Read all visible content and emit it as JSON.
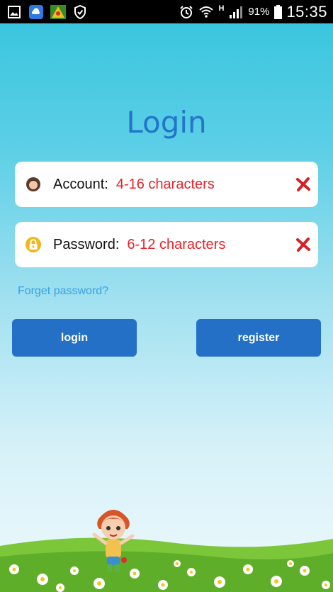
{
  "status_bar": {
    "network_type": "H",
    "battery_percent": "91%",
    "time": "15:35",
    "icons": [
      "gallery-icon",
      "cloud-app-icon",
      "game-app-icon",
      "shield-icon",
      "alarm-icon",
      "wifi-icon",
      "signal-icon",
      "battery-icon"
    ]
  },
  "title": "Login",
  "account": {
    "label": "Account:",
    "placeholder": "4-16 characters",
    "lead_icon": "avatar-icon",
    "clear_icon": "clear-icon"
  },
  "password": {
    "label": "Password:",
    "placeholder": "6-12 characters",
    "lead_icon": "lock-icon",
    "clear_icon": "clear-icon"
  },
  "forget_password": "Forget password?",
  "buttons": {
    "login": "login",
    "register": "register"
  },
  "colors": {
    "title": "#2275c9",
    "button": "#2470c6",
    "placeholder": "#e8232a",
    "link": "#3aa0e0"
  }
}
